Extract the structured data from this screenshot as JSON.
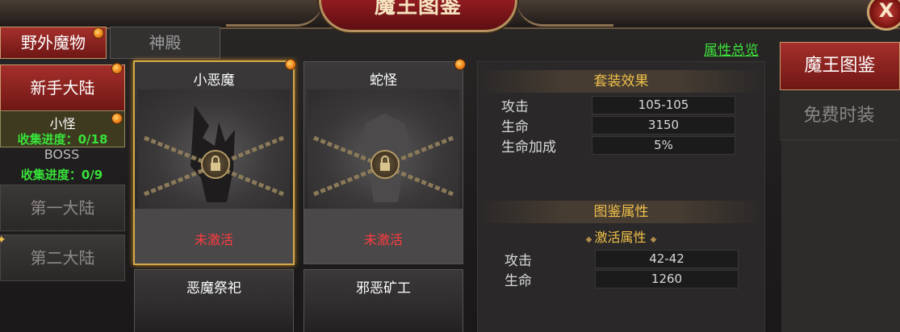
{
  "window": {
    "title": "魔王图鉴",
    "close_label": "X"
  },
  "tabs": [
    {
      "label": "野外魔物",
      "active": true
    },
    {
      "label": "神殿",
      "active": false
    }
  ],
  "left_nav": {
    "continent_active": "新手大陆",
    "sub_items": [
      {
        "label": "小怪",
        "progress": "收集进度：0/18"
      },
      {
        "label": "BOSS",
        "progress": "收集进度：0/9"
      }
    ],
    "continent_1": "第一大陆",
    "continent_2": "第二大陆"
  },
  "cards": [
    {
      "name": "小恶魔",
      "status": "未激活",
      "locked": true,
      "selected": true
    },
    {
      "name": "蛇怪",
      "status": "未激活",
      "locked": true,
      "selected": false
    },
    {
      "name": "恶魔祭祀",
      "status": "",
      "locked": true,
      "selected": false
    },
    {
      "name": "邪恶矿工",
      "status": "",
      "locked": true,
      "selected": false
    }
  ],
  "set_effect": {
    "title": "套装效果",
    "stats": [
      {
        "label": "攻击",
        "value": "105-105"
      },
      {
        "label": "生命",
        "value": "3150"
      },
      {
        "label": "生命加成",
        "value": "5%"
      }
    ]
  },
  "codex_attr": {
    "title": "图鉴属性",
    "sub_title": "激活属性",
    "stats": [
      {
        "label": "攻击",
        "value": "42-42"
      },
      {
        "label": "生命",
        "value": "1260"
      }
    ]
  },
  "overview_link": "属性总览",
  "right_tabs": [
    {
      "label": "魔王图鉴",
      "active": true
    },
    {
      "label": "免费时装",
      "active": false
    }
  ],
  "colors": {
    "accent_red": "#a52f2b",
    "progress_green": "#38e23a",
    "inactive_red": "#ff3b42",
    "header_gold": "#f0c04a"
  }
}
